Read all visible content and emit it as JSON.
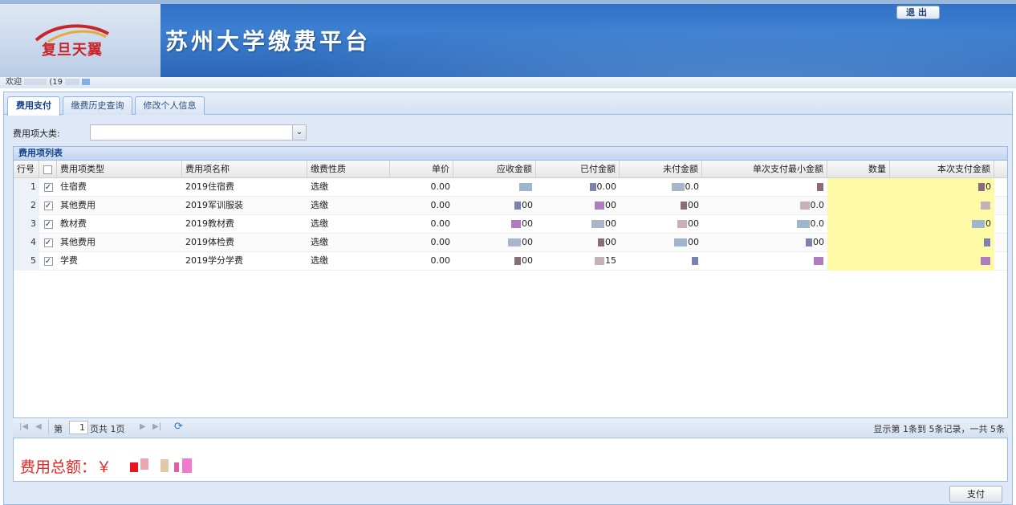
{
  "header": {
    "logo_text": "复旦天翼",
    "title": "苏州大学缴费平台",
    "logout_label": "退出"
  },
  "welcome": {
    "prefix": "欢迎",
    "paren": "(19"
  },
  "tabs": [
    {
      "label": "费用支付",
      "active": true
    },
    {
      "label": "缴费历史查询",
      "active": false
    },
    {
      "label": "修改个人信息",
      "active": false
    }
  ],
  "filter": {
    "label": "费用项大类:",
    "value": "",
    "trigger": "⌄"
  },
  "grid": {
    "title": "费用项列表",
    "columns": [
      "行号",
      "",
      "费用项类型",
      "费用项名称",
      "缴费性质",
      "单价",
      "应收金额",
      "已付金额",
      "未付金额",
      "单次支付最小金额",
      "数量",
      "本次支付金额"
    ],
    "rows": [
      {
        "no": "1",
        "checked": true,
        "type": "住宿费",
        "name": "2019住宿费",
        "nature": "选缴",
        "price": "0.00",
        "due": "",
        "paid": "0.00",
        "unpaid": "0.0",
        "min": "",
        "qty": "",
        "pay": "0"
      },
      {
        "no": "2",
        "checked": true,
        "type": "其他费用",
        "name": "2019军训服装",
        "nature": "选缴",
        "price": "0.00",
        "due": "00",
        "paid": "00",
        "unpaid": "00",
        "min": "0.0",
        "qty": "",
        "pay": ""
      },
      {
        "no": "3",
        "checked": true,
        "type": "教材费",
        "name": "2019教材费",
        "nature": "选缴",
        "price": "0.00",
        "due": "00",
        "paid": "00",
        "unpaid": "00",
        "min": "0.0",
        "qty": "",
        "pay": "0"
      },
      {
        "no": "4",
        "checked": true,
        "type": "其他费用",
        "name": "2019体检费",
        "nature": "选缴",
        "price": "0.00",
        "due": "00",
        "paid": "00",
        "unpaid": "00",
        "min": "00",
        "qty": "",
        "pay": ""
      },
      {
        "no": "5",
        "checked": true,
        "type": "学费",
        "name": "2019学分学费",
        "nature": "选缴",
        "price": "0.00",
        "due": "00",
        "paid": "15",
        "unpaid": "",
        "min": "",
        "qty": "",
        "pay": ""
      }
    ]
  },
  "pager": {
    "page_prefix": "第",
    "page_value": "1",
    "page_suffix": "页共 1页",
    "summary": "显示第 1条到 5条记录，一共 5条"
  },
  "total": {
    "label": "费用总额：￥"
  },
  "pay_button": "支付",
  "colors": {
    "accent": "#15428b",
    "total_red": "#e02a2a",
    "highlight": "#fffaa6"
  }
}
